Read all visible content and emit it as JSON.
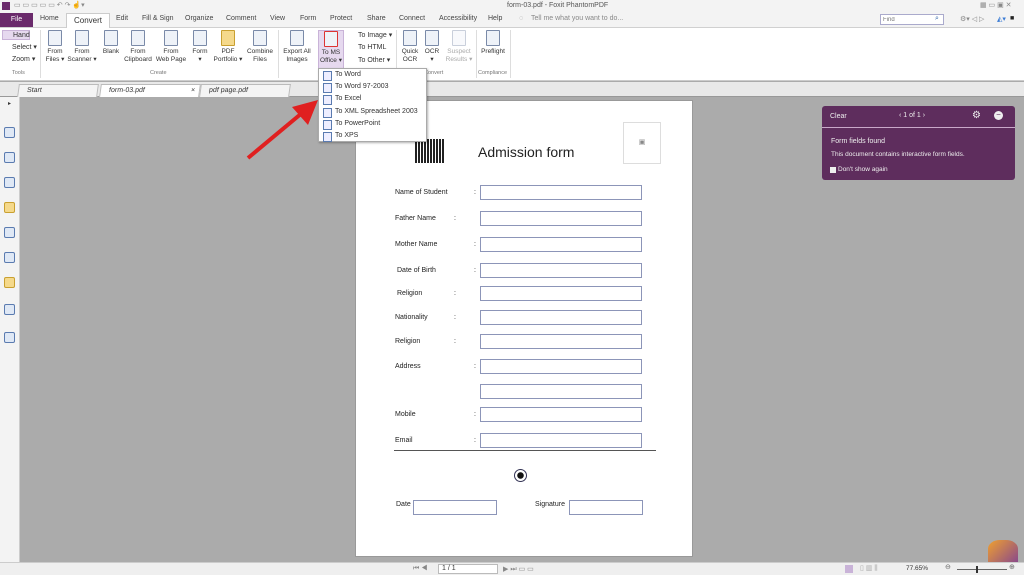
{
  "window": {
    "title": "form-03.pdf - Foxit PhantomPDF"
  },
  "menu": {
    "file": "File",
    "tabs": [
      "Home",
      "Convert",
      "Edit",
      "Fill & Sign",
      "Organize",
      "Comment",
      "View",
      "Form",
      "Protect",
      "Share",
      "Connect",
      "Accessibility",
      "Help"
    ],
    "tell_me": "Tell me what you want to do...",
    "find_placeholder": "Find"
  },
  "ribbon": {
    "tools": [
      "Hand",
      "Select ▾",
      "Zoom ▾"
    ],
    "tools_group": "Tools",
    "create": [
      {
        "l1": "From",
        "l2": "Files ▾"
      },
      {
        "l1": "From",
        "l2": "Scanner ▾"
      },
      {
        "l1": "Blank",
        "l2": ""
      },
      {
        "l1": "From",
        "l2": "Clipboard"
      },
      {
        "l1": "From",
        "l2": "Web Page"
      },
      {
        "l1": "Form",
        "l2": "▾"
      },
      {
        "l1": "PDF",
        "l2": "Portfolio ▾"
      },
      {
        "l1": "Combine",
        "l2": "Files"
      }
    ],
    "create_group": "Create",
    "export": {
      "l1": "Export All",
      "l2": "Images"
    },
    "to_office": {
      "l1": "To MS",
      "l2": "Office ▾"
    },
    "small": [
      "To Image ▾",
      "To HTML",
      "To Other ▾"
    ],
    "ocr": [
      {
        "l1": "Quick",
        "l2": "OCR"
      },
      {
        "l1": "OCR",
        "l2": "▾"
      },
      {
        "l1": "Suspect",
        "l2": "Results ▾"
      }
    ],
    "convert_group": "Convert",
    "preflight": "Preflight",
    "compliance_group": "Compliance"
  },
  "dropdown": [
    "To Word",
    "To Word 97-2003",
    "To Excel",
    "To XML Spreadsheet 2003",
    "To PowerPoint",
    "To XPS"
  ],
  "doc_tabs": [
    "Start",
    "form-03.pdf",
    "pdf page.pdf"
  ],
  "form": {
    "title": "Admission form",
    "rows": [
      {
        "label": "Name of Student"
      },
      {
        "label": "Father Name"
      },
      {
        "label": "Mother Name"
      },
      {
        "label": "Date of Birth"
      },
      {
        "label": "Religion"
      },
      {
        "label": "Nationality"
      },
      {
        "label": "Religion"
      },
      {
        "label": "Address"
      },
      {
        "label": ""
      },
      {
        "label": "Mobile"
      },
      {
        "label": "Email"
      }
    ],
    "colon": ":",
    "date": "Date",
    "signature": "Signature"
  },
  "panel": {
    "clear": "Clear",
    "pager": "‹  1 of 1  ›",
    "heading": "Form fields found",
    "message": "This document contains interactive form fields.",
    "dont_show": "Don't show again"
  },
  "status": {
    "page": "1 / 1",
    "zoom": "77.65%"
  },
  "colors": {
    "accent": "#6a2a6b",
    "panel": "#5e2d5d",
    "arrow": "#e02020"
  }
}
